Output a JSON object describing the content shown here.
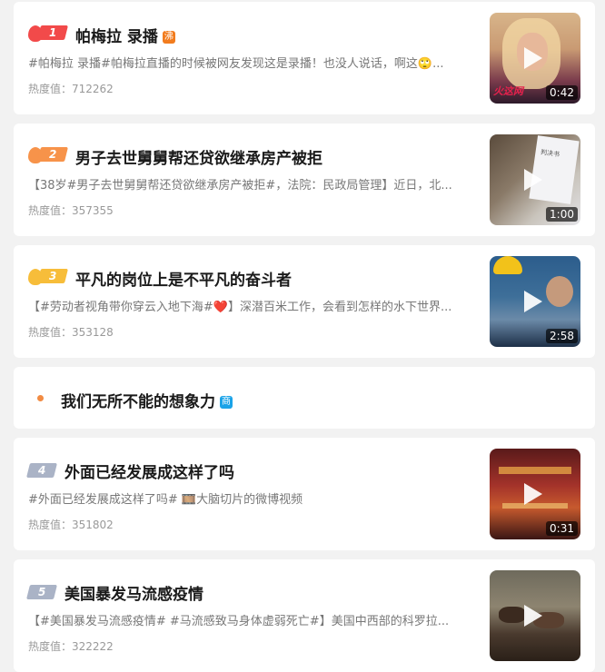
{
  "colors": {
    "rank1": "#f24a4a",
    "rank2": "#f7934a",
    "rank3": "#f7bd3a",
    "rank_other": "#aab3c6",
    "hot_badge": "#f27c1e",
    "ad_badge": "#1aa3e8"
  },
  "items": [
    {
      "rank": "1",
      "title": "帕梅拉 录播",
      "badge": "沸",
      "desc": "#帕梅拉 录播#帕梅拉直播的时候被网友发现这是录播！也没人说话，啊这🙄...",
      "heat": "热度值：712262",
      "duration": "0:42",
      "overlay_text": "火这网"
    },
    {
      "rank": "2",
      "title": "男子去世舅舅帮还贷欲继承房产被拒",
      "desc": "【38岁#男子去世舅舅帮还贷欲继承房产被拒#，法院：民政局管理】近日，北...",
      "heat": "热度值：357355",
      "duration": "1:00",
      "overlay_text": "判决书"
    },
    {
      "rank": "3",
      "title": "平凡的岗位上是不平凡的奋斗者",
      "desc": "【#劳动者视角带你穿云入地下海#❤️】深潜百米工作，会看到怎样的水下世界...",
      "heat": "热度值：353128",
      "duration": "2:58"
    },
    {
      "title": "我们无所不能的想象力",
      "badge": "商"
    },
    {
      "rank": "4",
      "title": "外面已经发展成这样了吗",
      "desc": "#外面已经发展成这样了吗# 🎞️大脑切片的微博视频",
      "heat": "热度值：351802",
      "duration": "0:31"
    },
    {
      "rank": "5",
      "title": "美国暴发马流感疫情",
      "desc": "【#美国暴发马流感疫情# #马流感致马身体虚弱死亡#】美国中西部的科罗拉...",
      "heat": "热度值：322222"
    }
  ]
}
